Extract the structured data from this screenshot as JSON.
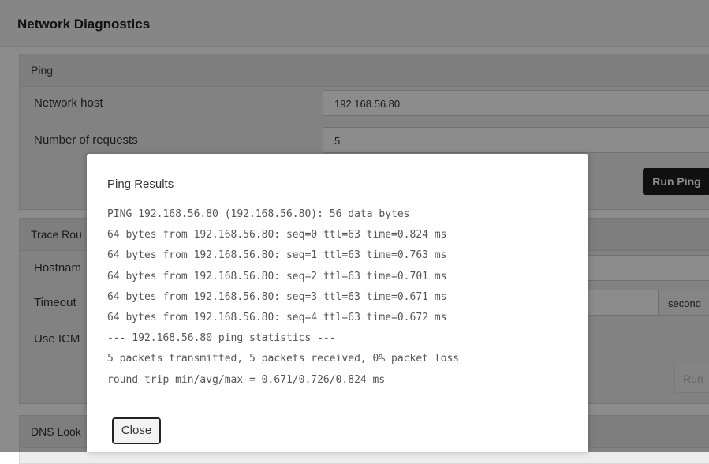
{
  "page": {
    "title": "Network Diagnostics"
  },
  "ping": {
    "section_title": "Ping",
    "host_label": "Network host",
    "host_value": "192.168.56.80",
    "requests_label": "Number of requests",
    "requests_value": "5",
    "run_label": "Run Ping"
  },
  "traceroute": {
    "section_title": "Trace Rou",
    "hostname_label": "Hostnam",
    "timeout_label": "Timeout",
    "timeout_unit": "second",
    "icmp_label": "Use ICM",
    "run_label": "Run"
  },
  "dns": {
    "section_title": "DNS Look"
  },
  "modal": {
    "title": "Ping Results",
    "lines": [
      "PING 192.168.56.80 (192.168.56.80): 56 data bytes",
      "64 bytes from 192.168.56.80: seq=0 ttl=63 time=0.824 ms",
      "64 bytes from 192.168.56.80: seq=1 ttl=63 time=0.763 ms",
      "64 bytes from 192.168.56.80: seq=2 ttl=63 time=0.701 ms",
      "64 bytes from 192.168.56.80: seq=3 ttl=63 time=0.671 ms",
      "64 bytes from 192.168.56.80: seq=4 ttl=63 time=0.672 ms",
      "--- 192.168.56.80 ping statistics ---",
      "5 packets transmitted, 5 packets received, 0% packet loss",
      "round-trip min/avg/max = 0.671/0.726/0.824 ms"
    ],
    "close_label": "Close"
  },
  "colors": {
    "overlay": "#000000",
    "dark_button": "#1e1e1e",
    "panel": "#ededed"
  }
}
